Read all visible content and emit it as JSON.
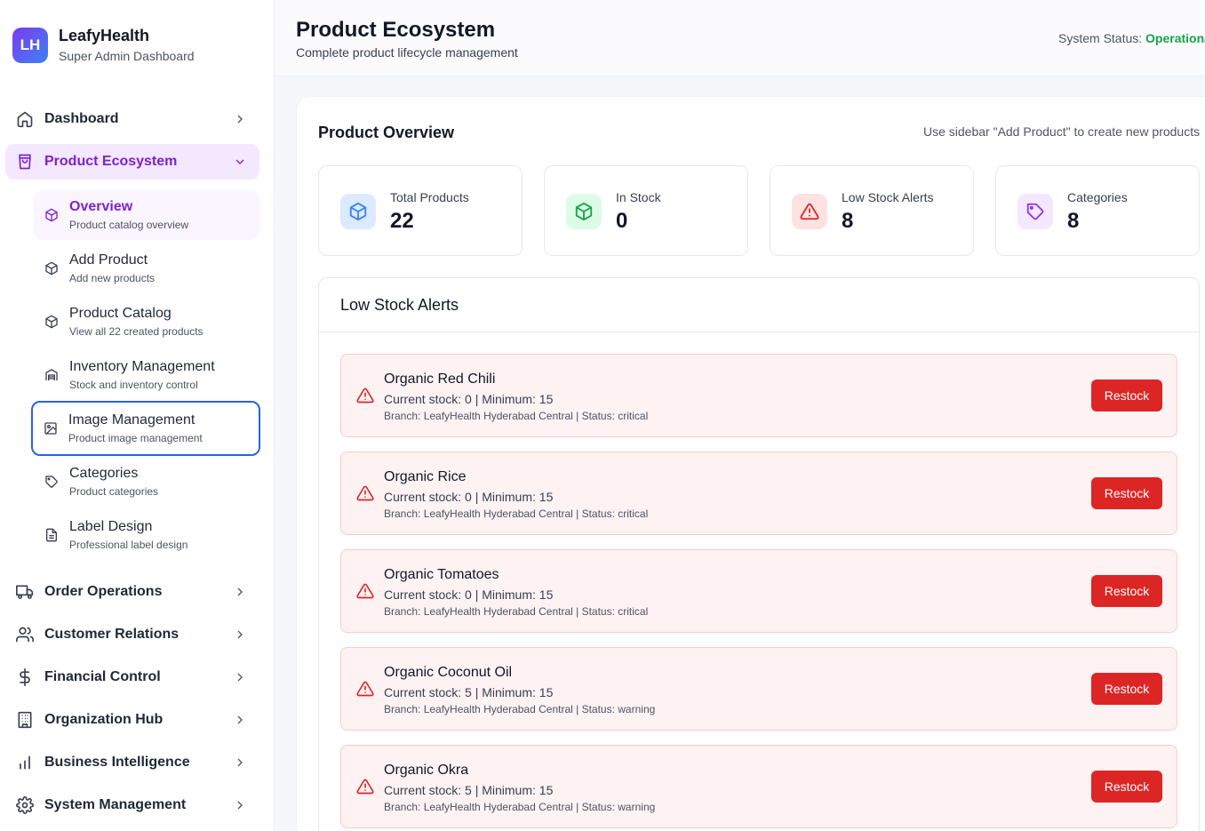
{
  "brand": {
    "logo": "LH",
    "name": "LeafyHealth",
    "subtitle": "Super Admin Dashboard"
  },
  "sidebar": {
    "items": [
      {
        "label": "Dashboard",
        "icon": "home-icon"
      },
      {
        "label": "Product Ecosystem",
        "icon": "shopping-bag-icon",
        "active": true,
        "expanded": true
      },
      {
        "label": "Order Operations",
        "icon": "truck-icon"
      },
      {
        "label": "Customer Relations",
        "icon": "users-icon"
      },
      {
        "label": "Financial Control",
        "icon": "dollar-icon"
      },
      {
        "label": "Organization Hub",
        "icon": "building-icon"
      },
      {
        "label": "Business Intelligence",
        "icon": "bar-chart-icon"
      },
      {
        "label": "System Management",
        "icon": "gear-icon"
      }
    ],
    "sub_items": [
      {
        "label": "Overview",
        "desc": "Product catalog overview",
        "icon": "package-icon",
        "active": true
      },
      {
        "label": "Add Product",
        "desc": "Add new products",
        "icon": "package-icon"
      },
      {
        "label": "Product Catalog",
        "desc": "View all 22 created products",
        "icon": "package-icon"
      },
      {
        "label": "Inventory Management",
        "desc": "Stock and inventory control",
        "icon": "warehouse-icon"
      },
      {
        "label": "Image Management",
        "desc": "Product image management",
        "icon": "image-icon",
        "focused": true
      },
      {
        "label": "Categories",
        "desc": "Product categories",
        "icon": "tag-icon"
      },
      {
        "label": "Label Design",
        "desc": "Professional label design",
        "icon": "file-text-icon"
      }
    ]
  },
  "header": {
    "title": "Product Ecosystem",
    "subtitle": "Complete product lifecycle management",
    "status_label": "System Status: ",
    "status_value": "Operational"
  },
  "overview": {
    "title": "Product Overview",
    "hint": "Use sidebar \"Add Product\" to create new products"
  },
  "stats": [
    {
      "label": "Total Products",
      "value": "22",
      "icon": "cube-icon",
      "color": "#3b82f6",
      "bg": "#dbeafe"
    },
    {
      "label": "In Stock",
      "value": "0",
      "icon": "cube-icon",
      "color": "#16a34a",
      "bg": "#dcfce7"
    },
    {
      "label": "Low Stock Alerts",
      "value": "8",
      "icon": "alert-triangle-icon",
      "color": "#dc2626",
      "bg": "#fee2e2"
    },
    {
      "label": "Categories",
      "value": "8",
      "icon": "tag-icon",
      "color": "#9333ea",
      "bg": "#f3e8ff"
    }
  ],
  "alerts": {
    "title": "Low Stock Alerts",
    "restock_label": "Restock",
    "items": [
      {
        "name": "Organic Red Chili",
        "stock": "Current stock: 0 | Minimum: 15",
        "branch": "Branch: LeafyHealth Hyderabad Central | Status: critical"
      },
      {
        "name": "Organic Rice",
        "stock": "Current stock: 0 | Minimum: 15",
        "branch": "Branch: LeafyHealth Hyderabad Central | Status: critical"
      },
      {
        "name": "Organic Tomatoes",
        "stock": "Current stock: 0 | Minimum: 15",
        "branch": "Branch: LeafyHealth Hyderabad Central | Status: critical"
      },
      {
        "name": "Organic Coconut Oil",
        "stock": "Current stock: 5 | Minimum: 15",
        "branch": "Branch: LeafyHealth Hyderabad Central | Status: warning"
      },
      {
        "name": "Organic Okra",
        "stock": "Current stock: 5 | Minimum: 15",
        "branch": "Branch: LeafyHealth Hyderabad Central | Status: warning"
      }
    ]
  },
  "colors": {
    "accent": "#7e22ce",
    "danger": "#dc2626",
    "success": "#16a34a"
  }
}
